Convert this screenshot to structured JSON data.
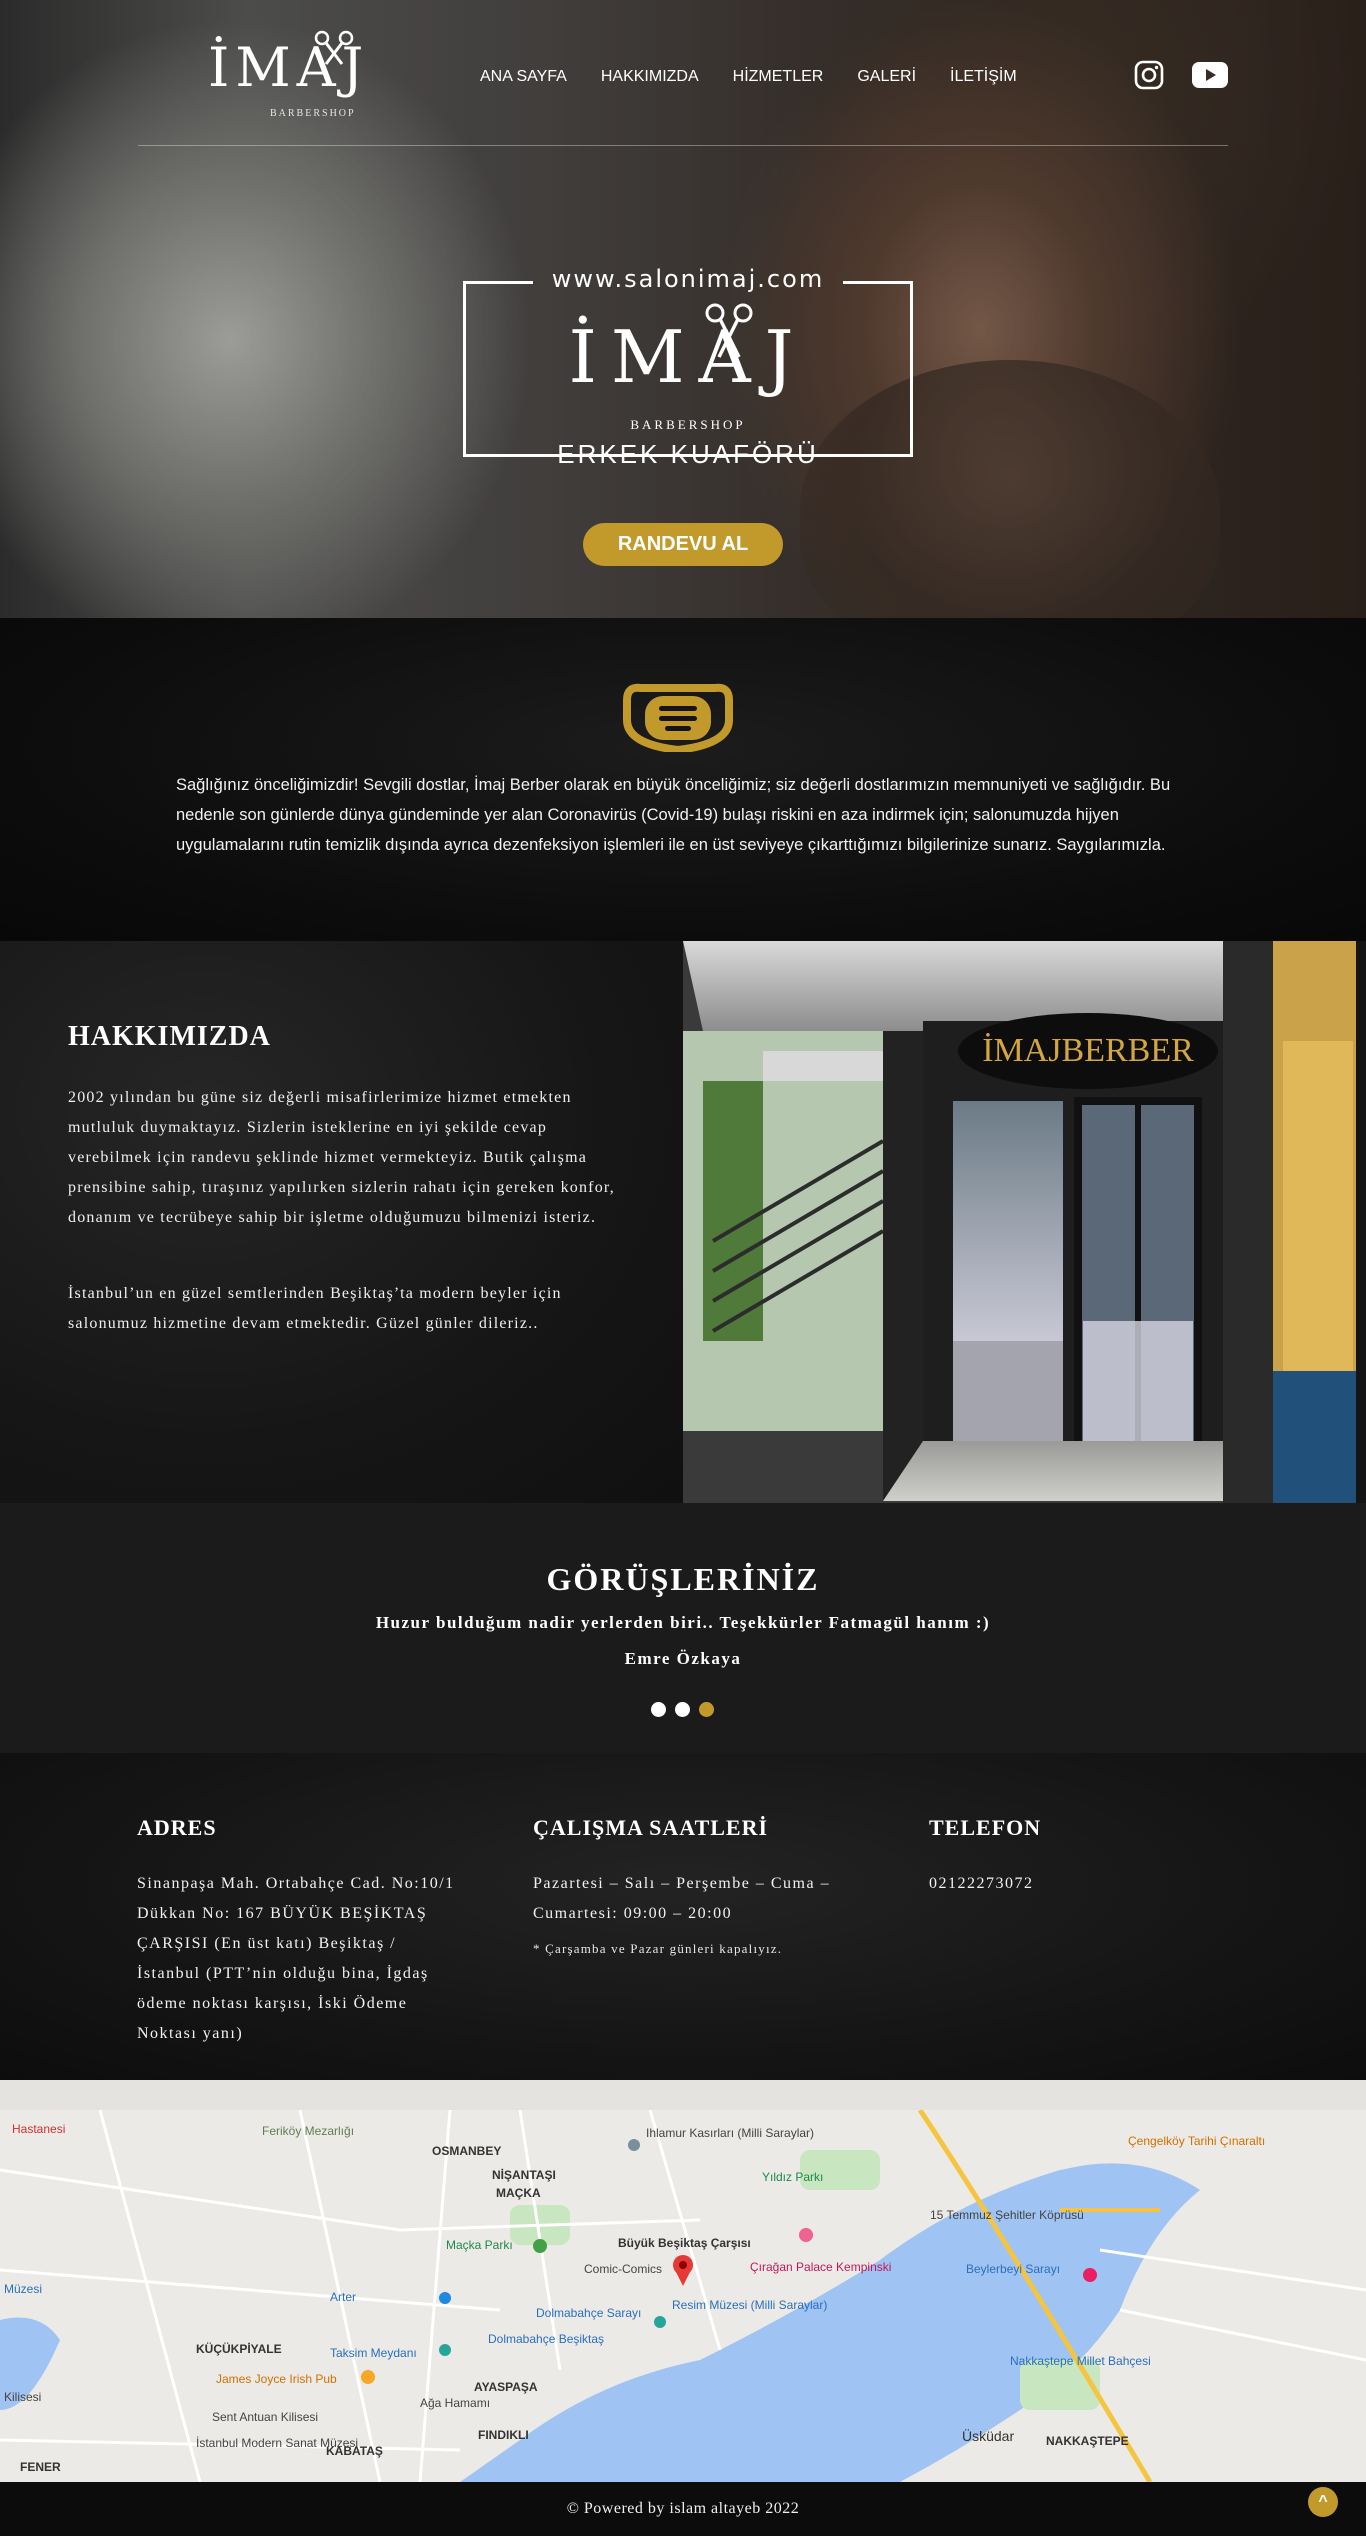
{
  "brand": {
    "logo_text": "İMAJ",
    "logo_sub": "BARBERSHOP"
  },
  "nav": {
    "items": [
      "ANA SAYFA",
      "HAKKIMIZDA",
      "HİZMETLER",
      "GALERİ",
      "İLETİŞİM"
    ],
    "social": [
      "instagram-icon",
      "youtube-icon"
    ]
  },
  "hero": {
    "url": "www.salonimaj.com",
    "logo_text": "İMAJ",
    "logo_sub": "BARBERSHOP",
    "tagline": "ERKEK KUAFÖRÜ",
    "cta_label": "RANDEVU AL"
  },
  "covid": {
    "icon": "face-mask-icon",
    "text": "Sağlığınız önceliğimizdir! Sevgili dostlar, İmaj Berber olarak en büyük önceliğimiz; siz değerli dostlarımızın memnuniyeti ve sağlığıdır. Bu nedenle son günlerde dünya gündeminde yer alan Coronavirüs (Covid-19) bulaşı riskini en aza indirmek için; salonumuzda hijyen uygulamalarını rutin temizlik dışında ayrıca dezenfeksiyon işlemleri ile en üst seviyeye çıkarttığımızı bilgilerinize sunarız. Saygılarımızla."
  },
  "about": {
    "title": "HAKKIMIZDA",
    "p1": "2002 yılından bu güne siz değerli misafirlerimize hizmet etmekten mutluluk duymaktayız. Sizlerin isteklerine en iyi şekilde cevap verebilmek için randevu şeklinde hizmet vermekteyiz. Butik çalışma prensibine sahip, tıraşınız yapılırken sizlerin rahatı için gereken konfor, donanım ve tecrübeye sahip bir işletme olduğumuzu bilmenizi isteriz.",
    "p2": "İstanbul’un en güzel semtlerinden Beşiktaş’ta modern beyler için salonumuz hizmetine devam etmektedir. Güzel günler dileriz..",
    "photo_sign": "İMAJBERBER"
  },
  "testimonials": {
    "title": "GÖRÜŞLERİNİZ",
    "quote": "Huzur bulduğum nadir yerlerden biri.. Teşekkürler Fatmagül hanım :)",
    "author": "Emre Özkaya",
    "active_slide": 3,
    "slide_count": 3
  },
  "info": {
    "address_title": "ADRES",
    "address_text": "Sinanpaşa Mah. Ortabahçe Cad. No:10/1 Dükkan No: 167 BÜYÜK BEŞİKTAŞ ÇARŞISI (En üst katı) Beşiktaş / İstanbul (PTT’nin olduğu bina, İgdaş ödeme noktası karşısı, İski Ödeme Noktası yanı)",
    "hours_title": "ÇALIŞMA SAATLERİ",
    "hours_text": "Pazartesi – Salı – Perşembe – Cuma – Cumartesi: 09:00 – 20:00",
    "hours_note": "* Çarşamba ve Pazar günleri kapalıyız.",
    "phone_title": "TELEFON",
    "phone": "02122273072"
  },
  "map": {
    "labels": [
      "Hastanesi",
      "Feriköy Mezarlığı",
      "OSMANBEY",
      "NİŞANTAŞI",
      "MAÇKA",
      "Ihlamur Kasırları (Milli Saraylar)",
      "Yıldız Parkı",
      "Çengelköy Tarihi Çınaraltı",
      "15 Temmuz Şehitler Köprüsü",
      "Maçka Parkı",
      "Büyük Beşiktaş Çarşısı",
      "Comic-Comics",
      "Çırağan Palace Kempinski",
      "Beylerbeyi Sarayı",
      "Arter",
      "Dolmabahçe Sarayı",
      "Resim Müzesi (Milli Saraylar)",
      "Dolmabahçe Beşiktaş",
      "KÜÇÜKPİYALE",
      "Taksim Meydanı",
      "James Joyce Irish Pub",
      "AYASPAŞA",
      "Ağa Hamamı",
      "Sent Antuan Kilisesi",
      "FINDIKLI",
      "İstanbul Modern Sanat Müzesi",
      "KABATAŞ",
      "Nakkaştepe Millet Bahçesi",
      "Üsküdar",
      "NAKKAŞTEPE",
      "FENER",
      "Kilisesi",
      "Müzesi"
    ]
  },
  "footer": {
    "copyright": "© Powered by islam altayeb 2022",
    "to_top": "^"
  },
  "colors": {
    "accent": "#c29a2c",
    "dark_bg": "#141414",
    "map_water": "#9fc3f2"
  }
}
